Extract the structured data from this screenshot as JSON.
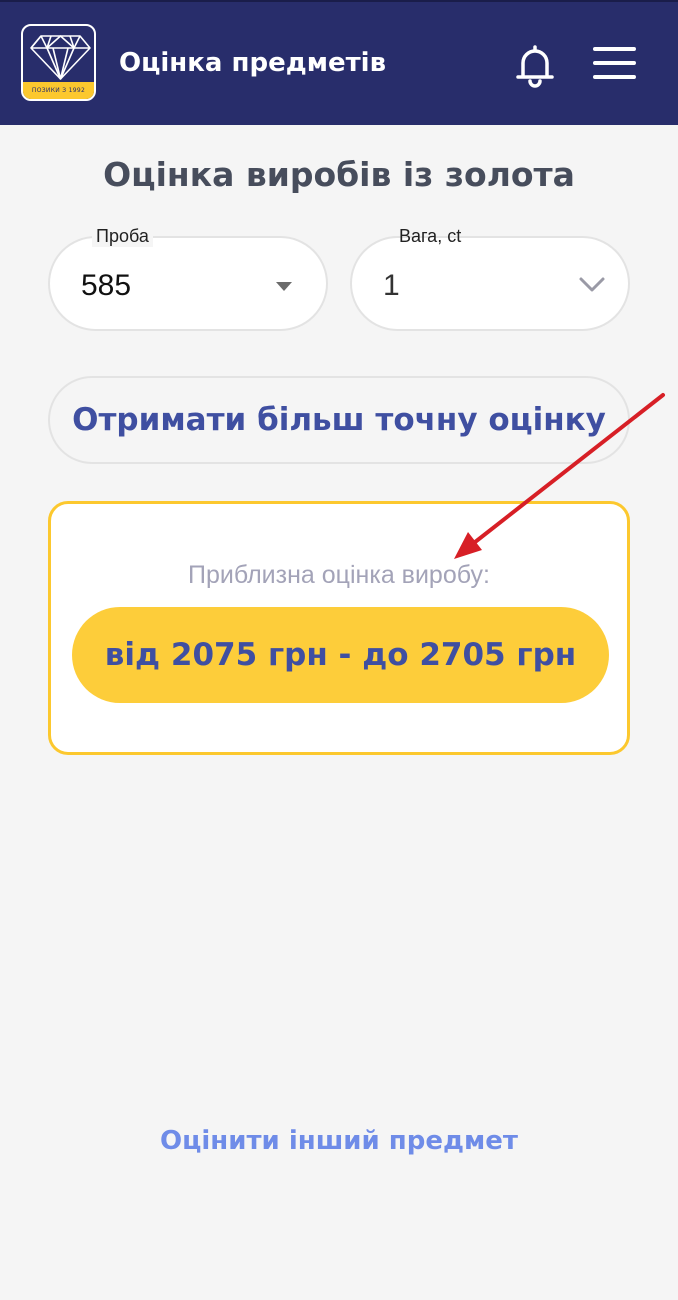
{
  "header": {
    "logo_strip_text": "ПОЗИКИ З 1992",
    "title": "Оцінка предметів",
    "icons": [
      "diamond-logo-icon",
      "bell-icon",
      "hamburger-menu-icon"
    ]
  },
  "page": {
    "heading": "Оцінка виробів із золота"
  },
  "fields": {
    "probe": {
      "label": "Проба",
      "value": "585"
    },
    "weight": {
      "label": "Вага, ct",
      "value": "1"
    }
  },
  "accurate_button": {
    "label": "Отримати більш точну оцінку"
  },
  "result": {
    "label": "Приблизна оцінка виробу:",
    "value": "від 2075 грн - до 2705 грн"
  },
  "other_item_link": {
    "label": "Оцінити інший предмет"
  },
  "colors": {
    "header_bg": "#282d6b",
    "accent_yellow": "#fcc82e",
    "primary_text": "#3f4fa1",
    "link": "#6f8ce8",
    "annotation_arrow": "#d71f26"
  }
}
